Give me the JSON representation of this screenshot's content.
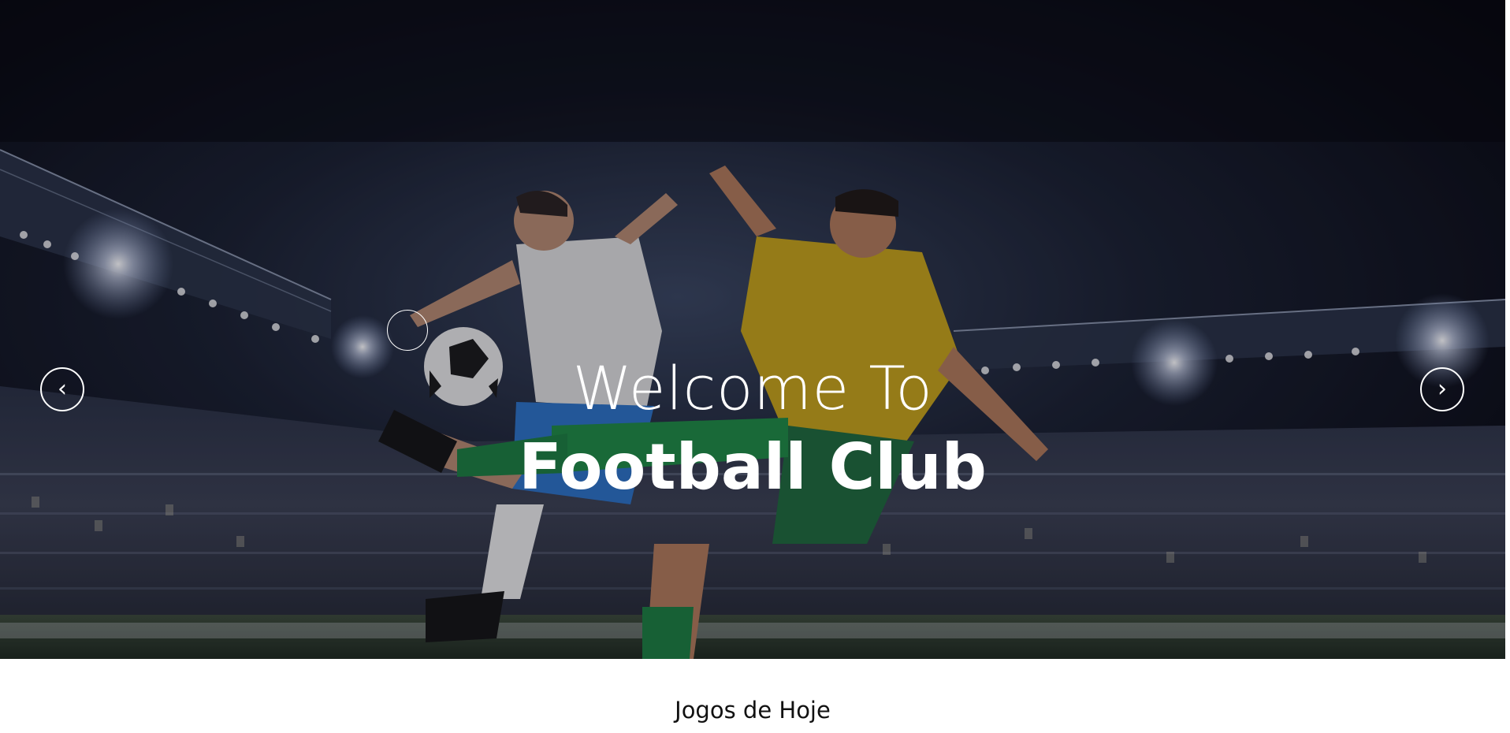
{
  "hero": {
    "title_line1": "Welcome To",
    "title_line2": "Football Club",
    "prev_arrow": "‹",
    "next_arrow": "›",
    "icons": {
      "prev": "chevron-left-icon",
      "next": "chevron-right-icon"
    },
    "colors": {
      "overlay": "#060814",
      "text": "#ffffff"
    }
  },
  "section": {
    "title": "Jogos de Hoje"
  }
}
